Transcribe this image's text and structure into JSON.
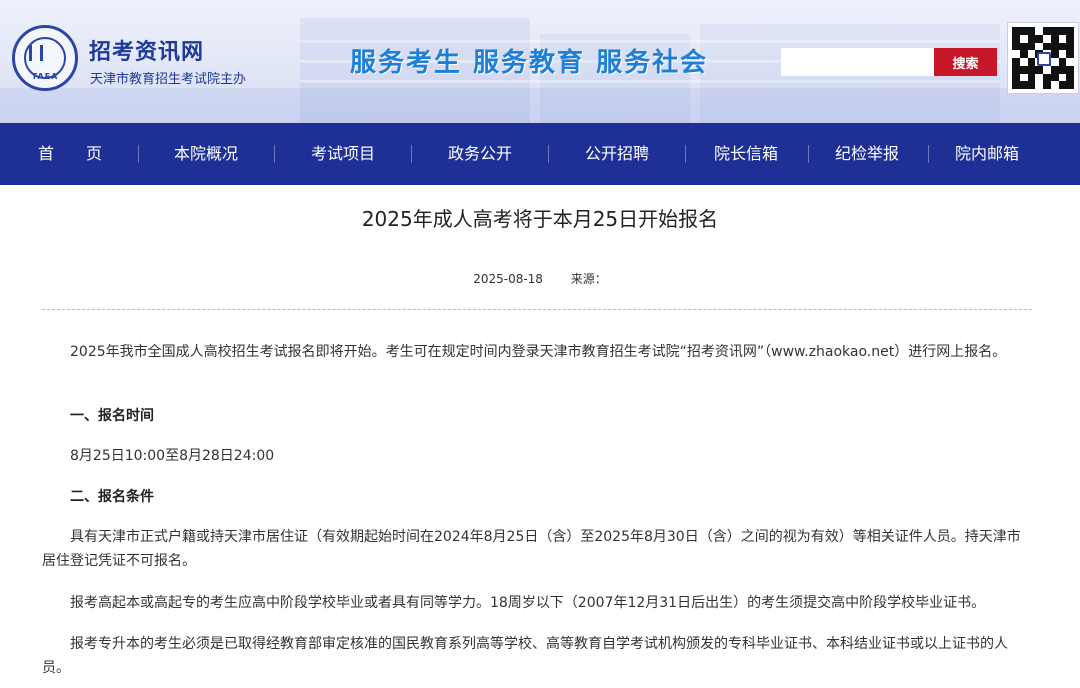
{
  "header": {
    "logo_abbr": "TAEA",
    "site_name": "招考资讯网",
    "site_subtitle": "天津市教育招生考试院主办",
    "slogan": "服务考生  服务教育  服务社会",
    "search_placeholder": "",
    "search_button": "搜索",
    "accent_color": "#1e2f95",
    "search_button_color": "#c8162b",
    "slogan_color": "#1d7fd6"
  },
  "nav": {
    "items": [
      {
        "label": "首　　页"
      },
      {
        "label": "本院概况"
      },
      {
        "label": "考试项目"
      },
      {
        "label": "政务公开"
      },
      {
        "label": "公开招聘"
      },
      {
        "label": "院长信箱"
      },
      {
        "label": "纪检举报"
      },
      {
        "label": "院内邮箱"
      }
    ]
  },
  "article": {
    "title": "2025年成人高考将于本月25日开始报名",
    "date": "2025-08-18",
    "source_label": "来源：",
    "intro": "2025年我市全国成人高校招生考试报名即将开始。考生可在规定时间内登录天津市教育招生考试院“招考资讯网”（www.zhaokao.net）进行网上报名。",
    "section1_title": "一、报名时间",
    "section1_text": "8月25日10:00至8月28日24:00",
    "section2_title": "二、报名条件",
    "para1": "具有天津市正式户籍或持天津市居住证（有效期起始时间在2024年8月25日（含）至2025年8月30日（含）之间的视为有效）等相关证件人员。持天津市居住登记凭证不可报名。",
    "para2": "报考高起本或高起专的考生应高中阶段学校毕业或者具有同等学力。18周岁以下（2007年12月31日后出生）的考生须提交高中阶段学校毕业证书。",
    "para3": "报考专升本的考生必须是已取得经教育部审定核准的国民教育系列高等学校、高等教育自学考试机构颁发的专科毕业证书、本科结业证书或以上证书的人员。"
  }
}
